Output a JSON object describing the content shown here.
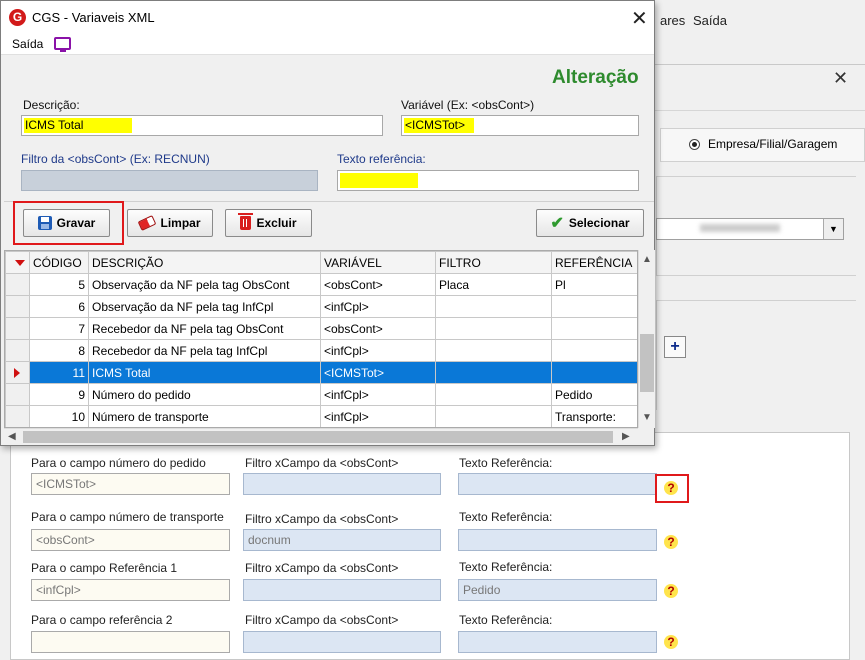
{
  "background": {
    "top_menu": {
      "ares": "ares",
      "saida": "Saída"
    },
    "radio_label": "Empresa/Filial/Garagem",
    "plus_label": "+",
    "rows": [
      {
        "label1": "Para o campo número do pedido",
        "label2": "Filtro xCampo da <obsCont>",
        "label3": "Texto Referência:",
        "value1": "<ICMSTot>",
        "value2": "",
        "value3": ""
      },
      {
        "label1": "Para o campo número de transporte",
        "label2": "Filtro xCampo da <obsCont>",
        "label3": "Texto Referência:",
        "value1": "<obsCont>",
        "value2": "docnum",
        "value3": ""
      },
      {
        "label1": "Para o campo Referência 1",
        "label2": "Filtro xCampo da <obsCont>",
        "label3": "Texto Referência:",
        "value1": "<infCpl>",
        "value2": "",
        "value3": "Pedido"
      },
      {
        "label1": "Para o campo referência 2",
        "label2": "Filtro xCampo da <obsCont>",
        "label3": "Texto Referência:",
        "value1": "",
        "value2": "",
        "value3": ""
      }
    ],
    "help_mark": "?"
  },
  "dialog": {
    "logo": "G",
    "title": "CGS - Variaveis XML",
    "close": "✕",
    "menu": {
      "saida": "Saída"
    },
    "mode": "Alteração",
    "form": {
      "descricao_label": "Descrição:",
      "descricao_value": "ICMS Total",
      "variavel_label": "Variável (Ex: <obsCont>)",
      "variavel_value": "<ICMSTot>",
      "filtro_label": "Filtro da <obsCont> (Ex: RECNUN)",
      "filtro_value": "",
      "texto_label": "Texto referência:",
      "texto_value": ""
    },
    "buttons": {
      "gravar": "Gravar",
      "limpar": "Limpar",
      "excluir": "Excluir",
      "selecionar": "Selecionar"
    },
    "grid": {
      "columns": [
        "CÓDIGO",
        "DESCRIÇÃO",
        "VARIÁVEL",
        "FILTRO",
        "REFERÊNCIA"
      ],
      "rows": [
        {
          "codigo": "5",
          "descricao": "Observação da NF pela tag ObsCont",
          "variavel": "<obsCont>",
          "filtro": "Placa",
          "referencia": "Pl"
        },
        {
          "codigo": "6",
          "descricao": "Observação da NF pela tag InfCpl",
          "variavel": "<infCpl>",
          "filtro": "",
          "referencia": ""
        },
        {
          "codigo": "7",
          "descricao": "Recebedor da NF pela tag ObsCont",
          "variavel": "<obsCont>",
          "filtro": "",
          "referencia": ""
        },
        {
          "codigo": "8",
          "descricao": "Recebedor da NF pela tag InfCpl",
          "variavel": "<infCpl>",
          "filtro": "",
          "referencia": ""
        },
        {
          "codigo": "11",
          "descricao": "ICMS Total",
          "variavel": "<ICMSTot>",
          "filtro": "",
          "referencia": ""
        },
        {
          "codigo": "9",
          "descricao": "Número do pedido",
          "variavel": "<infCpl>",
          "filtro": "",
          "referencia": "Pedido"
        },
        {
          "codigo": "10",
          "descricao": "Número de transporte",
          "variavel": "<infCpl>",
          "filtro": "",
          "referencia": "Transporte:"
        }
      ],
      "selected_index": 4
    },
    "scroll": {
      "up": "▲",
      "down": "▼",
      "left": "◀",
      "right": "▶"
    }
  },
  "colors": {
    "selection": "#0a78d7",
    "highlight": "#ffff00",
    "mode_title": "#2e8b2e",
    "callout": "#e0191b"
  }
}
